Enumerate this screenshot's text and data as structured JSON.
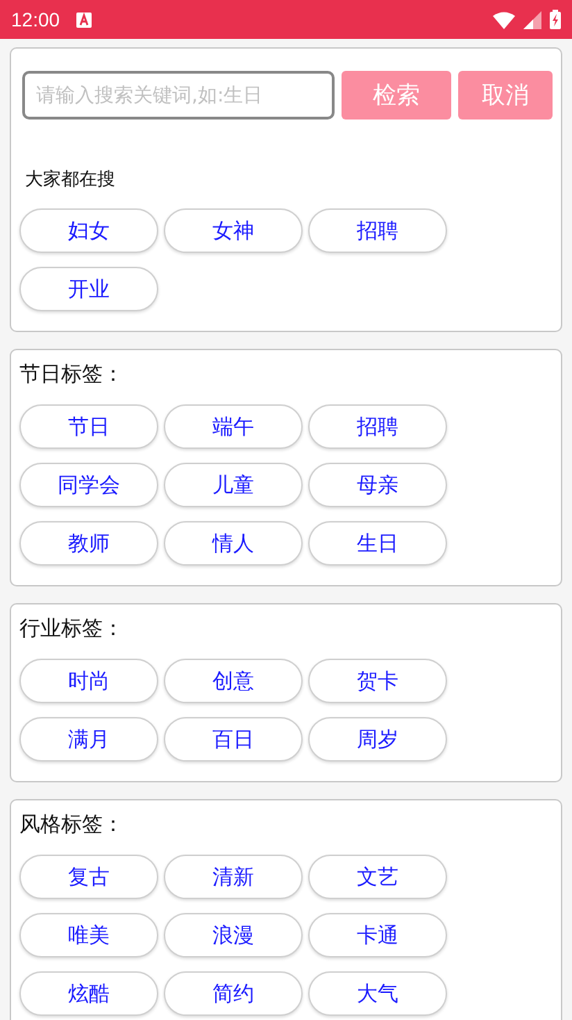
{
  "status_bar": {
    "time": "12:00"
  },
  "search": {
    "placeholder": "请输入搜索关键词,如:生日",
    "buttons": [
      "检索",
      "取消"
    ],
    "popular_title": "大家都在搜",
    "popular_tags": [
      "妇女",
      "女神",
      "招聘",
      "开业"
    ]
  },
  "sections": [
    {
      "title": "节日标签：",
      "tags": [
        "节日",
        "端午",
        "招聘",
        "同学会",
        "儿童",
        "母亲",
        "教师",
        "情人",
        "生日"
      ]
    },
    {
      "title": "行业标签：",
      "tags": [
        "时尚",
        "创意",
        "贺卡",
        "满月",
        "百日",
        "周岁"
      ]
    },
    {
      "title": "风格标签：",
      "tags": [
        "复古",
        "清新",
        "文艺",
        "唯美",
        "浪漫",
        "卡通",
        "炫酷",
        "简约",
        "大气"
      ]
    }
  ]
}
